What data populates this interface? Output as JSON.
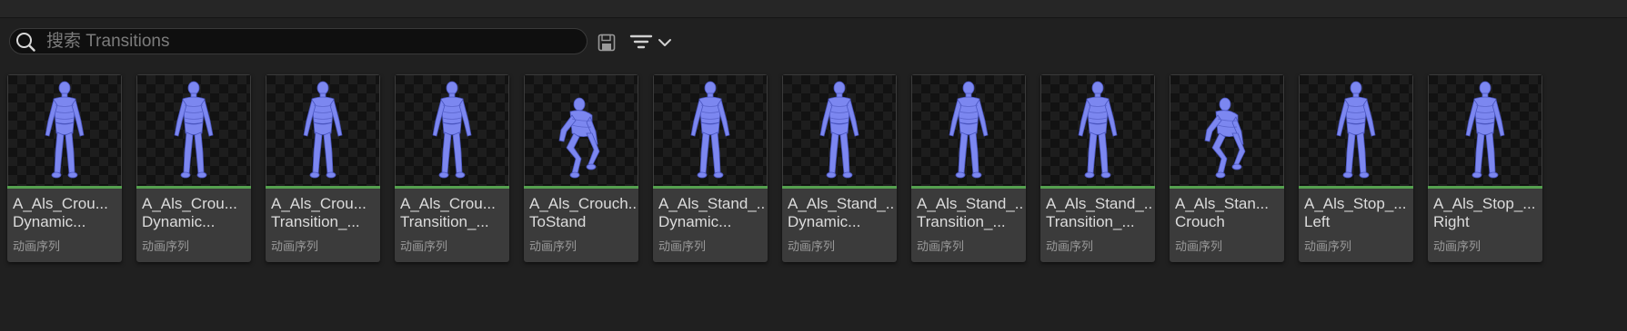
{
  "search": {
    "placeholder": "搜索 Transitions",
    "value": ""
  },
  "toolbar": {
    "save_icon": "save-icon",
    "filter_icon": "filter-icon",
    "dropdown_icon": "chevron-down-icon"
  },
  "colors": {
    "asset_type_bar": "#55a04f",
    "mannequin": "#7c87f0"
  },
  "assets": [
    {
      "line1": "A_Als_Crou...",
      "line2": "Dynamic...",
      "type": "动画序列",
      "pose": "standing"
    },
    {
      "line1": "A_Als_Crou...",
      "line2": "Dynamic...",
      "type": "动画序列",
      "pose": "standing"
    },
    {
      "line1": "A_Als_Crou...",
      "line2": "Transition_...",
      "type": "动画序列",
      "pose": "standing"
    },
    {
      "line1": "A_Als_Crou...",
      "line2": "Transition_...",
      "type": "动画序列",
      "pose": "standing"
    },
    {
      "line1": "A_Als_Crouch...",
      "line2": "ToStand",
      "type": "动画序列",
      "pose": "crouching"
    },
    {
      "line1": "A_Als_Stand_...",
      "line2": "Dynamic...",
      "type": "动画序列",
      "pose": "standing"
    },
    {
      "line1": "A_Als_Stand_...",
      "line2": "Dynamic...",
      "type": "动画序列",
      "pose": "standing"
    },
    {
      "line1": "A_Als_Stand_...",
      "line2": "Transition_...",
      "type": "动画序列",
      "pose": "standing"
    },
    {
      "line1": "A_Als_Stand_...",
      "line2": "Transition_...",
      "type": "动画序列",
      "pose": "standing"
    },
    {
      "line1": "A_Als_Stan...",
      "line2": "Crouch",
      "type": "动画序列",
      "pose": "crouching"
    },
    {
      "line1": "A_Als_Stop_...",
      "line2": "Left",
      "type": "动画序列",
      "pose": "standing"
    },
    {
      "line1": "A_Als_Stop_...",
      "line2": "Right",
      "type": "动画序列",
      "pose": "standing"
    }
  ]
}
